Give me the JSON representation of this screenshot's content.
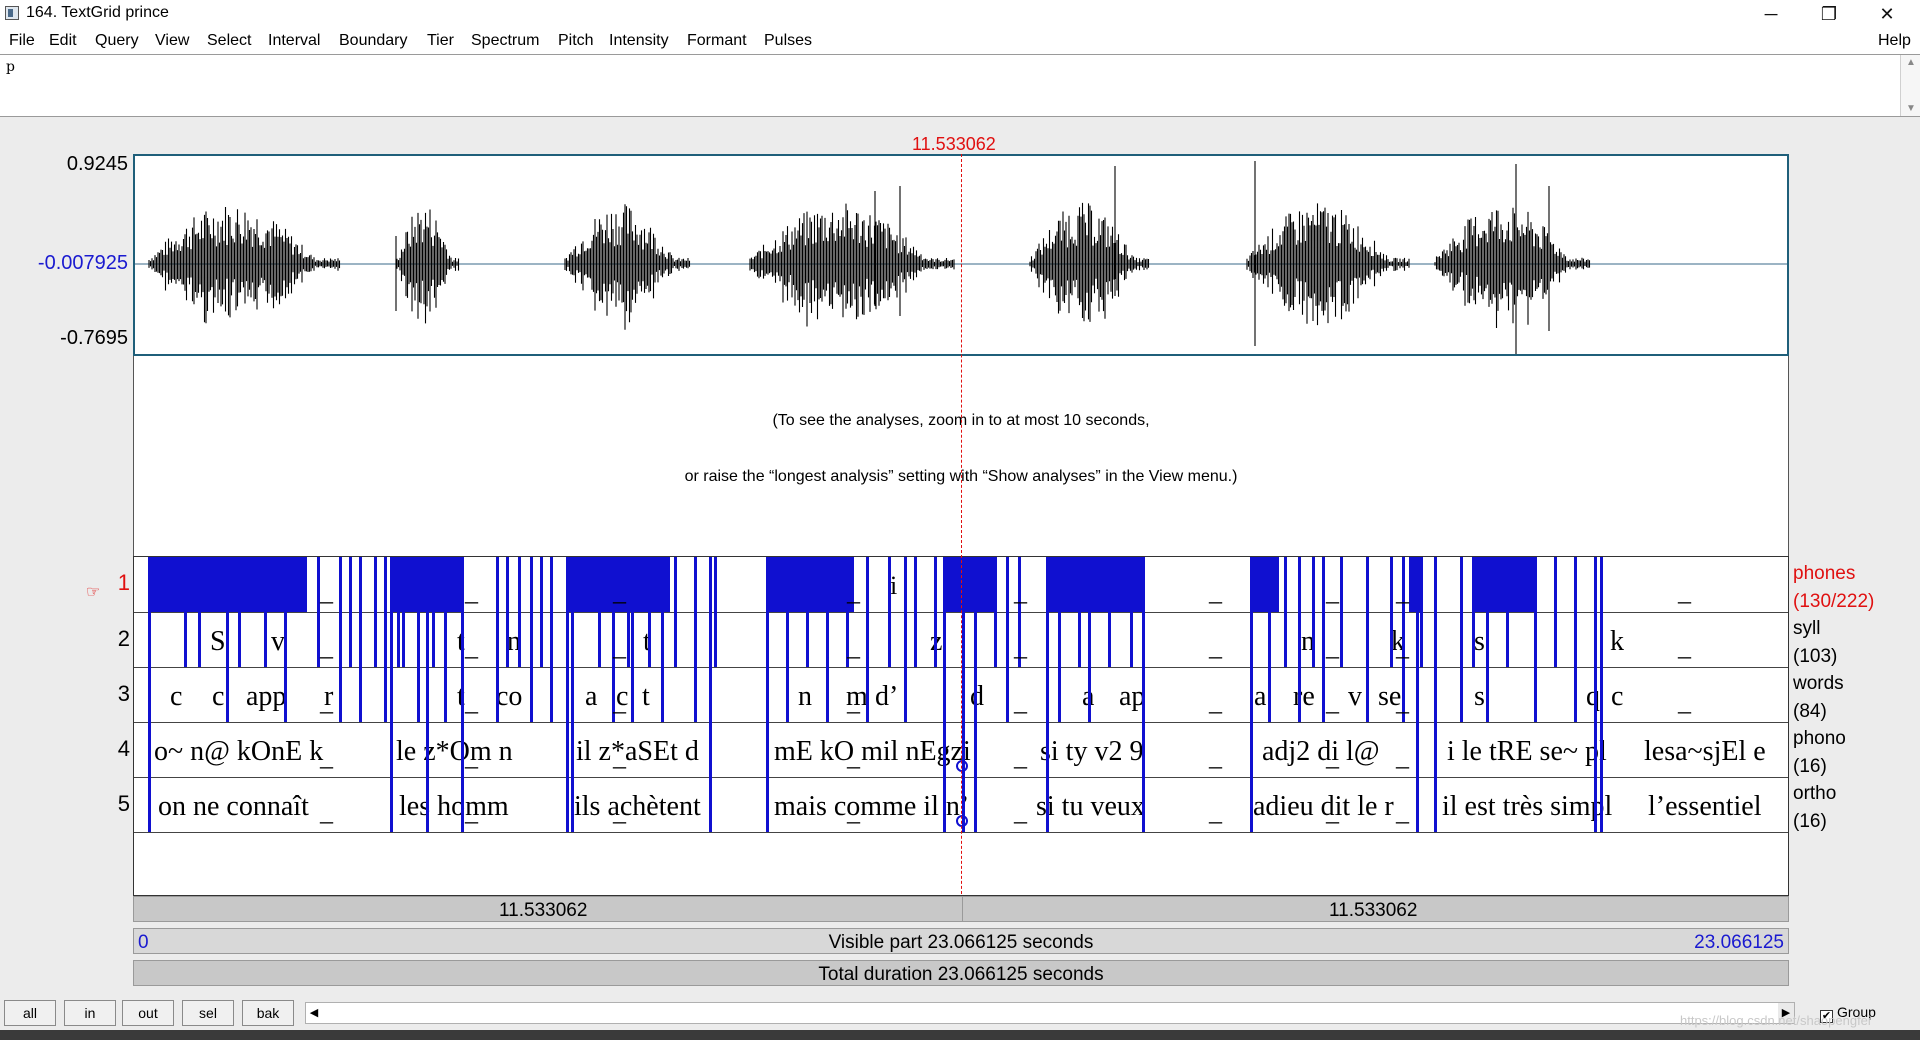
{
  "window": {
    "title": "164. TextGrid prince",
    "minimize": "─",
    "maximize": "❐",
    "close": "✕"
  },
  "menu": {
    "items": [
      "File",
      "Edit",
      "Query",
      "View",
      "Select",
      "Interval",
      "Boundary",
      "Tier",
      "Spectrum",
      "Pitch",
      "Intensity",
      "Formant",
      "Pulses"
    ],
    "help": "Help"
  },
  "text_field": {
    "value": "p"
  },
  "waveform": {
    "max_label": "0.9245",
    "zero_label": "-0.007925",
    "min_label": "-0.7695"
  },
  "cursor": {
    "time": "11.533062"
  },
  "analysis_message": {
    "line1": "(To see the analyses, zoom in to at most 10 seconds,",
    "line2": "or raise the “longest analysis” setting with “Show analyses” in the View menu.)"
  },
  "tiers": [
    {
      "number": "1",
      "name": "phones",
      "count": "(130/222)",
      "selected": true
    },
    {
      "number": "2",
      "name": "syll",
      "count": "(103)",
      "selected": false
    },
    {
      "number": "3",
      "name": "words",
      "count": "(84)",
      "selected": false
    },
    {
      "number": "4",
      "name": "phono",
      "count": "(16)",
      "selected": false
    },
    {
      "number": "5",
      "name": "ortho",
      "count": "(16)",
      "selected": false
    }
  ],
  "tier_texts": {
    "phones": [
      "i",
      "i"
    ],
    "syll": [
      "S",
      "v",
      "t",
      "n",
      "t",
      "z",
      "n",
      "k",
      "s",
      "k"
    ],
    "words": [
      "c",
      "c",
      "app",
      "r",
      "t",
      "co",
      "a",
      "c",
      "t",
      "n",
      "m",
      "d’",
      "d",
      "a",
      "ap",
      "a",
      "re",
      "v",
      "se",
      "s",
      "q",
      "c"
    ],
    "phono": [
      "o~ n@ kOnE k",
      "le z*Om n",
      "il z*aSEt d",
      "mE kO mil nEgzi",
      "si ty v2 9",
      "adj2 di l@",
      "i le tRE se~ pl",
      "lesa~sjEl e"
    ],
    "ortho": [
      "on ne connaît",
      "les homm",
      "ils achètent",
      "mais comme il n’",
      "si tu veux",
      "adieu dit le r",
      "il est très simpl",
      "l’essentiel"
    ],
    "gap_mark": "_"
  },
  "time_rows": {
    "left_part": "11.533062",
    "right_part": "11.533062",
    "visible_start": "0",
    "visible_label": "Visible part 23.066125 seconds",
    "visible_end": "23.066125",
    "total_label": "Total duration 23.066125 seconds"
  },
  "bottom_buttons": [
    "all",
    "in",
    "out",
    "sel",
    "bak"
  ],
  "group_label": "Group",
  "watermark": "https://blog.csdn.net/shaopengfei",
  "colors": {
    "cursor": "#e01010",
    "boundary": "#1010d0",
    "wave_border": "#1f5f7a",
    "time_range": "#1a1ad0"
  }
}
